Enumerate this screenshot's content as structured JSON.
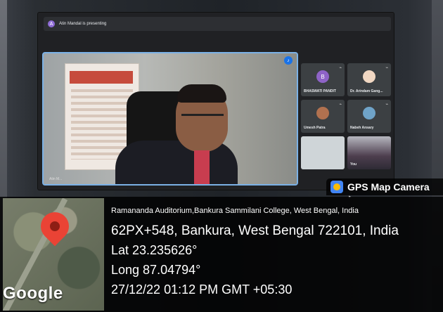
{
  "meeting": {
    "presenting_text": "Atin Mandal is presenting",
    "main_label": "Atin M...",
    "tiles": [
      {
        "name": "BHASWATI PANDIT",
        "avatar": "B",
        "color": "#8e63c7"
      },
      {
        "name": "Dr. Arindam Gang...",
        "avatar": "",
        "color": "#5f6368"
      },
      {
        "name": "Umesh Patra",
        "avatar": "",
        "color": "#5f6368"
      },
      {
        "name": "Nabeh Ansary",
        "avatar": "",
        "color": "#5f6368"
      },
      {
        "name": "",
        "avatar": "",
        "color": "#5f6368"
      },
      {
        "name": "You",
        "avatar": "",
        "color": "#5f6368"
      }
    ]
  },
  "gps": {
    "app_title": "GPS Map Camera",
    "map_brand": "Google",
    "address_line1": "Ramananda Auditorium,Bankura Sammilani College, West Bengal, India",
    "address_line2": "62PX+548, Bankura, West Bengal 722101, India",
    "lat": "Lat 23.235626°",
    "long": "Long 87.04794°",
    "timestamp": "27/12/22 01:12 PM GMT +05:30"
  }
}
